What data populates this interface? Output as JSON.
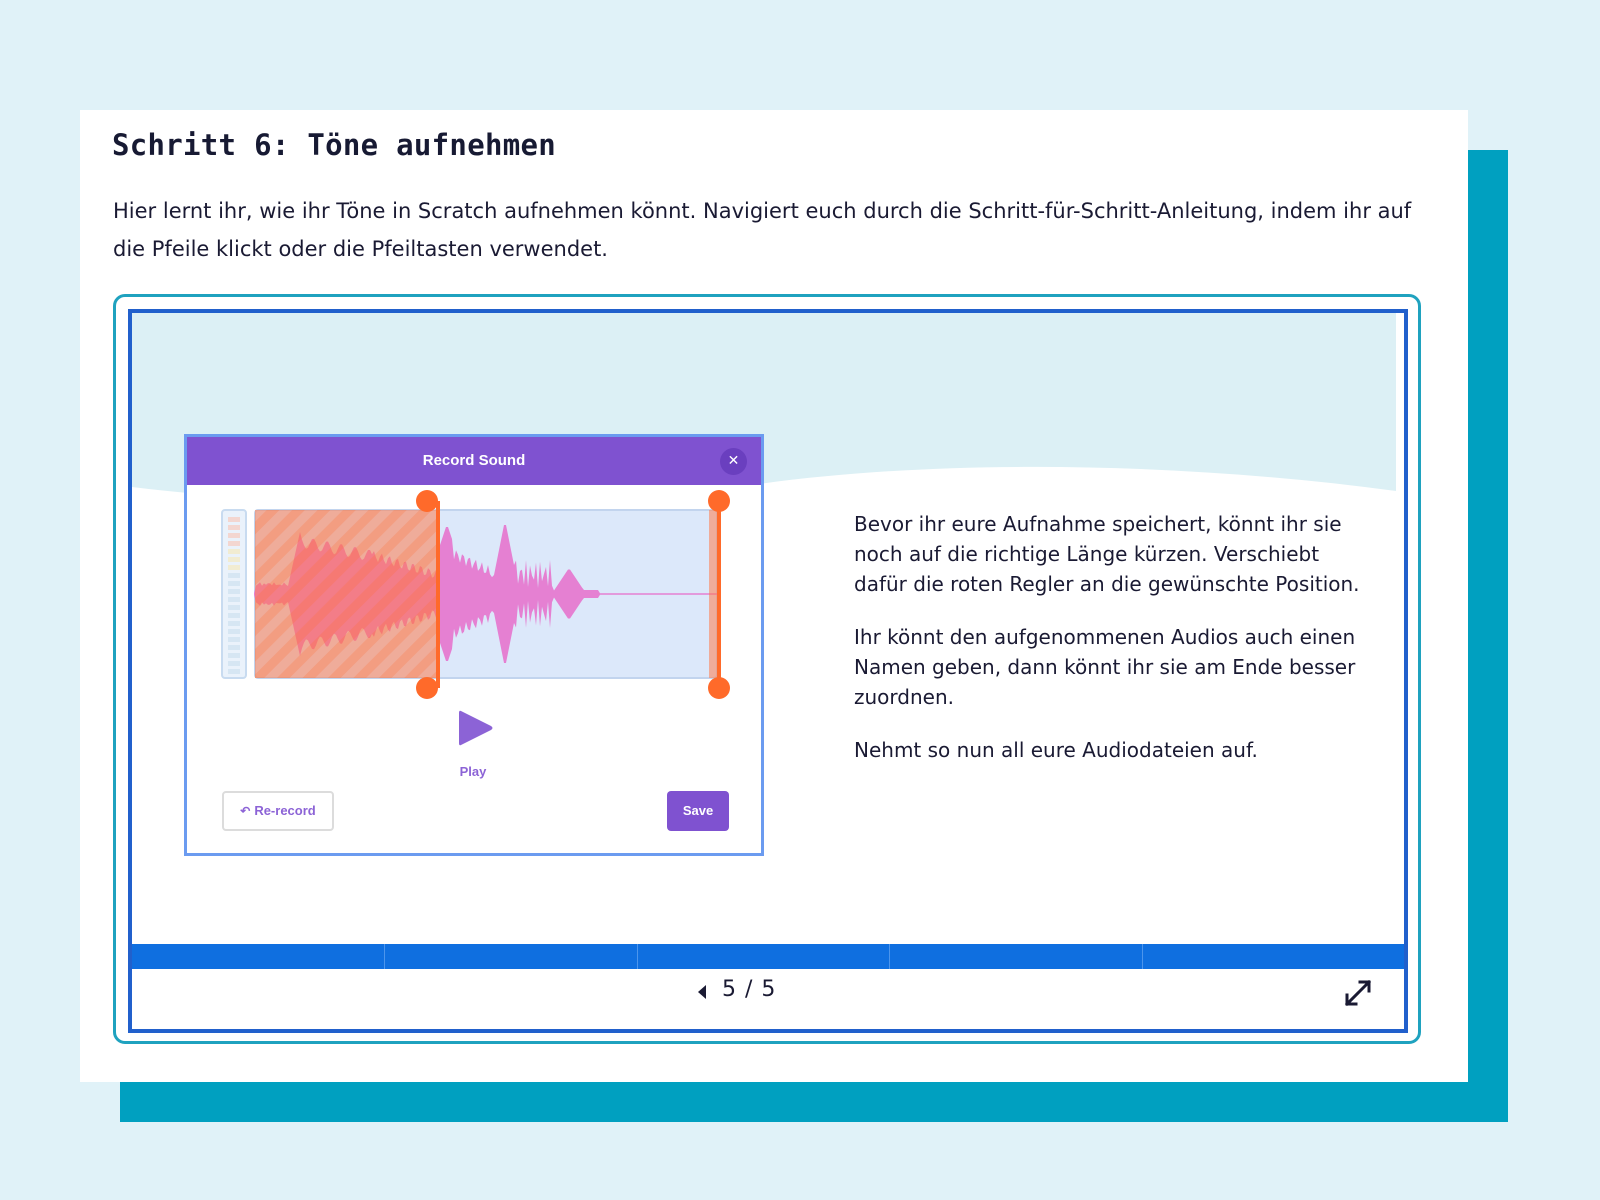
{
  "header": {
    "title": "Schritt 6: Töne aufnehmen",
    "intro": "Hier lernt ihr, wie ihr Töne in Scratch aufnehmen könnt. Navigiert euch durch die Schritt-für-Schritt-Anleitung, indem ihr auf die Pfeile klickt oder die Pfeiltasten verwendet."
  },
  "slide": {
    "dialog": {
      "title": "Record Sound",
      "close_icon": "close-icon",
      "play_label": "Play",
      "rerecord_label": "Re-record",
      "save_label": "Save"
    },
    "paragraphs": [
      "Bevor ihr eure Aufnahme speichert, könnt ihr sie noch auf die richtige Länge kürzen. Verschiebt dafür die roten Regler an die gewünschte Position.",
      "Ihr könnt den aufgenommenen Audios auch einen Namen geben, dann könnt ihr sie am Ende besser zuordnen.",
      "Nehmt so nun all eure Audiodateien auf."
    ]
  },
  "navigation": {
    "current_page": 5,
    "total_pages": 5,
    "counter": "5 / 5",
    "progress": 1.0,
    "segments": 5,
    "icons": [
      "prev-arrow-icon",
      "expand-icon"
    ]
  },
  "colors": {
    "accent_teal": "#00a0c0",
    "slide_border": "#2160cc",
    "progress_blue": "#0f6fe0",
    "scratch_purple": "#7f52d0",
    "trim_handle": "#ff6a2a",
    "waveform_pink": "#e580d2"
  }
}
